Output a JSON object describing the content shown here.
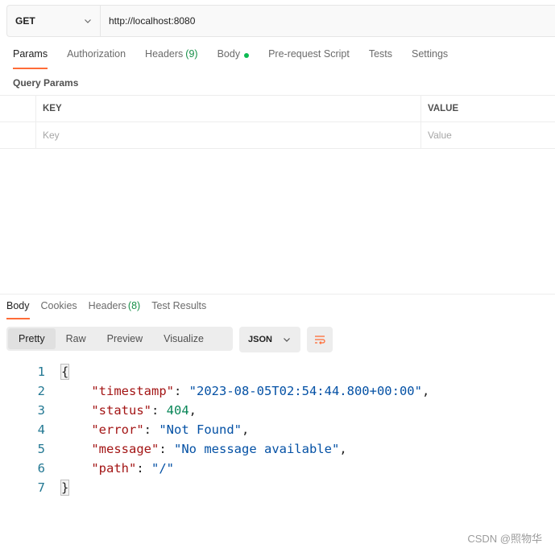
{
  "request": {
    "method": "GET",
    "url": "http://localhost:8080"
  },
  "request_tabs": [
    {
      "label": "Params",
      "count": ""
    },
    {
      "label": "Authorization",
      "count": ""
    },
    {
      "label": "Headers",
      "count": "(9)"
    },
    {
      "label": "Body",
      "count": ""
    },
    {
      "label": "Pre-request Script",
      "count": ""
    },
    {
      "label": "Tests",
      "count": ""
    },
    {
      "label": "Settings",
      "count": ""
    }
  ],
  "query_params": {
    "title": "Query Params",
    "col_key": "KEY",
    "col_value": "VALUE",
    "key_placeholder": "Key",
    "value_placeholder": "Value"
  },
  "response_tabs": [
    {
      "label": "Body",
      "count": ""
    },
    {
      "label": "Cookies",
      "count": ""
    },
    {
      "label": "Headers",
      "count": "(8)"
    },
    {
      "label": "Test Results",
      "count": ""
    }
  ],
  "view_modes": [
    "Pretty",
    "Raw",
    "Preview",
    "Visualize"
  ],
  "format": "JSON",
  "code": {
    "line_numbers": [
      "1",
      "2",
      "3",
      "4",
      "5",
      "6",
      "7"
    ],
    "open_brace": "{",
    "close_brace": "}",
    "fields": [
      {
        "key": "\"timestamp\"",
        "value": "\"2023-08-05T02:54:44.800+00:00\"",
        "type": "string",
        "trail": ","
      },
      {
        "key": "\"status\"",
        "value": "404",
        "type": "number",
        "trail": ","
      },
      {
        "key": "\"error\"",
        "value": "\"Not Found\"",
        "type": "string",
        "trail": ","
      },
      {
        "key": "\"message\"",
        "value": "\"No message available\"",
        "type": "string",
        "trail": ","
      },
      {
        "key": "\"path\"",
        "value": "\"/\"",
        "type": "string",
        "trail": ""
      }
    ]
  },
  "watermark": "CSDN @照物华",
  "colors": {
    "accent": "#ff6c37",
    "count_green": "#168f48",
    "body_dot": "#0cbb52"
  }
}
